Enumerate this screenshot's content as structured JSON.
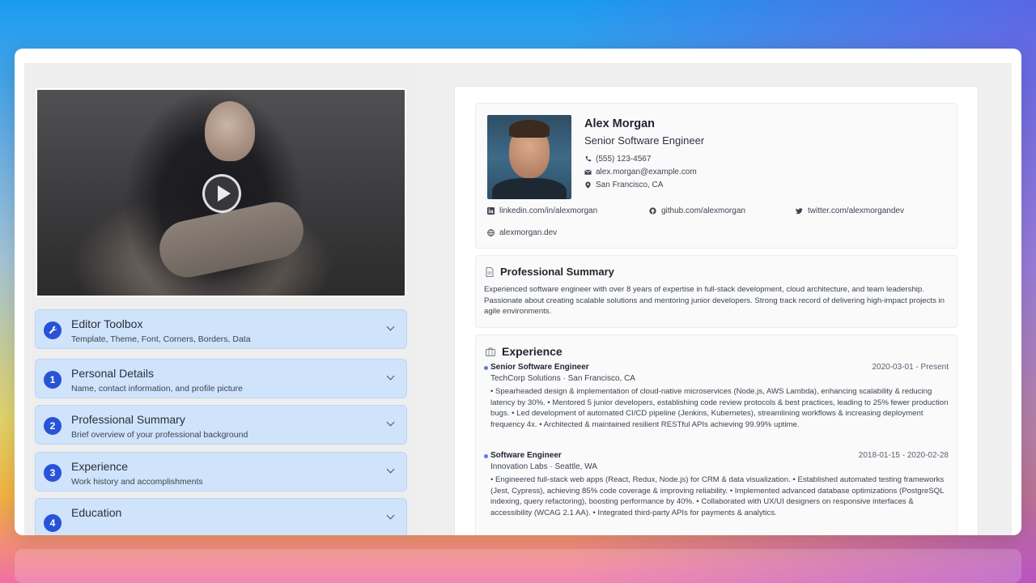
{
  "video": {
    "play_label": "Play"
  },
  "accordion": [
    {
      "badge": "",
      "title": "Editor Toolbox",
      "subtitle": "Template, Theme, Font, Corners, Borders, Data"
    },
    {
      "badge": "1",
      "title": "Personal Details",
      "subtitle": "Name, contact information, and profile picture"
    },
    {
      "badge": "2",
      "title": "Professional Summary",
      "subtitle": "Brief overview of your professional background"
    },
    {
      "badge": "3",
      "title": "Experience",
      "subtitle": "Work history and accomplishments"
    },
    {
      "badge": "4",
      "title": "Education",
      "subtitle": ""
    }
  ],
  "resume": {
    "name": "Alex Morgan",
    "role": "Senior Software Engineer",
    "phone": "(555) 123-4567",
    "email": "alex.morgan@example.com",
    "location": "San Francisco, CA",
    "links": {
      "linkedin": "linkedin.com/in/alexmorgan",
      "github": "github.com/alexmorgan",
      "twitter": "twitter.com/alexmorgandev",
      "website": "alexmorgan.dev"
    },
    "summary": {
      "heading": "Professional Summary",
      "text": "Experienced software engineer with over 8 years of expertise in full-stack development, cloud architecture, and team leadership. Passionate about creating scalable solutions and mentoring junior developers. Strong track record of delivering high-impact projects in agile environments."
    },
    "experience": {
      "heading": "Experience",
      "jobs": [
        {
          "title": "Senior Software Engineer",
          "dates": "2020-03-01 - Present",
          "company": "TechCorp Solutions · San Francisco, CA",
          "bullets": "• Spearheaded design & implementation of cloud-native microservices (Node.js, AWS Lambda), enhancing scalability & reducing latency by 30%. • Mentored 5 junior developers, establishing code review protocols & best practices, leading to 25% fewer production bugs. • Led development of automated CI/CD pipeline (Jenkins, Kubernetes), streamlining workflows & increasing deployment frequency 4x. • Architected & maintained resilient RESTful APIs achieving 99.99% uptime."
        },
        {
          "title": "Software Engineer",
          "dates": "2018-01-15 - 2020-02-28",
          "company": "Innovation Labs · Seattle, WA",
          "bullets": "• Engineered full-stack web apps (React, Redux, Node.js) for CRM & data visualization. • Established automated testing frameworks (Jest, Cypress), achieving 85% code coverage & improving reliability. • Implemented advanced database optimizations (PostgreSQL indexing, query refactoring), boosting performance by 40%. • Collaborated with UX/UI designers on responsive interfaces & accessibility (WCAG 2.1 AA). • Integrated third-party APIs for payments & analytics."
        }
      ]
    }
  },
  "colors": {
    "accent": "#2853d6",
    "accordion_bg": "#cfe3fb",
    "panel_bg": "#eeeeee"
  }
}
